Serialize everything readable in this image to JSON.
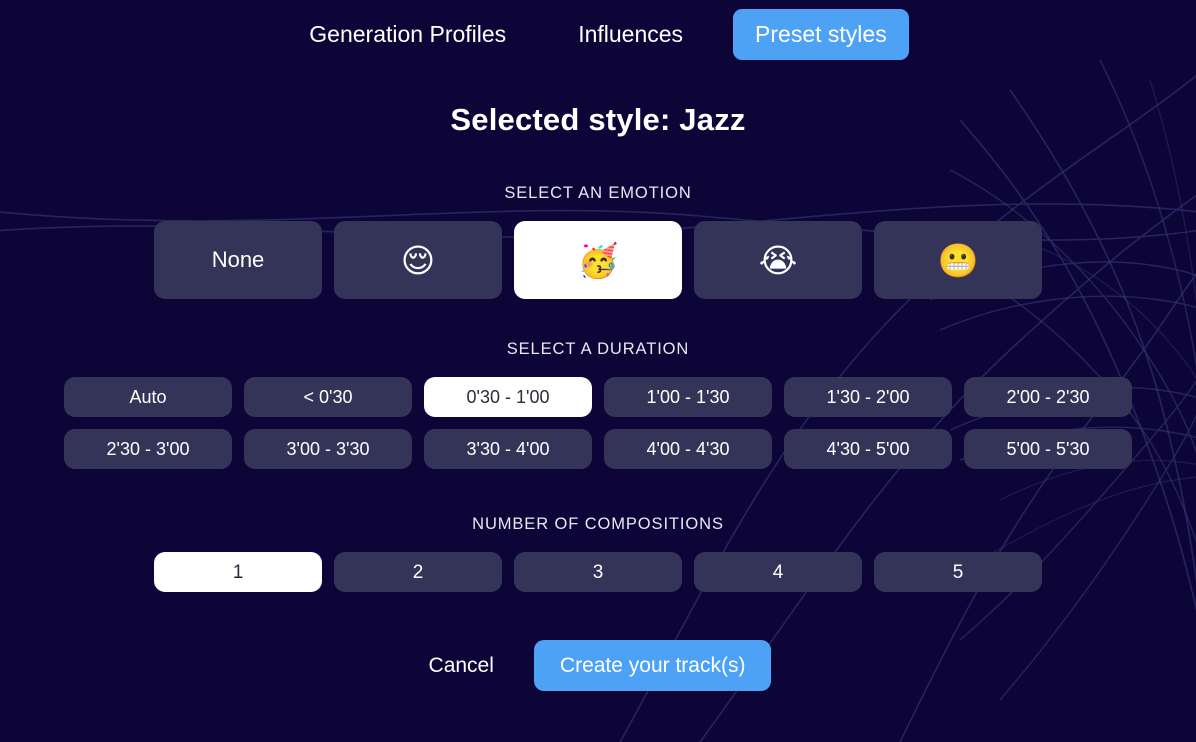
{
  "app": {
    "background_color": "#0d0538",
    "accent_color": "#4da2f5",
    "option_color": "#343459",
    "selected_color": "#ffffff"
  },
  "tabs": [
    {
      "label": "Generation Profiles",
      "active": false,
      "name": "tab-generation-profiles"
    },
    {
      "label": "Influences",
      "active": false,
      "name": "tab-influences"
    },
    {
      "label": "Preset styles",
      "active": true,
      "name": "tab-preset-styles"
    }
  ],
  "headline": "Selected style: Jazz",
  "sections": {
    "emotion": {
      "label": "SELECT AN EMOTION",
      "options": [
        {
          "label": "None",
          "icon": "",
          "icon_name": "none-label",
          "selected": false
        },
        {
          "label": "",
          "icon": "😌",
          "icon_name": "relieved-face-emoji",
          "selected": false
        },
        {
          "label": "",
          "icon": "🥳",
          "icon_name": "partying-face-emoji",
          "selected": true
        },
        {
          "label": "",
          "icon": "😭",
          "icon_name": "loudly-crying-emoji",
          "selected": false
        },
        {
          "label": "",
          "icon": "😬",
          "icon_name": "grimacing-face-emoji",
          "selected": false
        }
      ]
    },
    "duration": {
      "label": "SELECT A DURATION",
      "options": [
        {
          "label": "Auto",
          "selected": false
        },
        {
          "label": "< 0'30",
          "selected": false
        },
        {
          "label": "0'30 - 1'00",
          "selected": true
        },
        {
          "label": "1'00 - 1'30",
          "selected": false
        },
        {
          "label": "1'30 - 2'00",
          "selected": false
        },
        {
          "label": "2'00 - 2'30",
          "selected": false
        },
        {
          "label": "2'30 - 3'00",
          "selected": false
        },
        {
          "label": "3'00 - 3'30",
          "selected": false
        },
        {
          "label": "3'30 - 4'00",
          "selected": false
        },
        {
          "label": "4'00 - 4'30",
          "selected": false
        },
        {
          "label": "4'30 - 5'00",
          "selected": false
        },
        {
          "label": "5'00 - 5'30",
          "selected": false
        }
      ]
    },
    "compositions": {
      "label": "NUMBER OF COMPOSITIONS",
      "options": [
        {
          "label": "1",
          "selected": true
        },
        {
          "label": "2",
          "selected": false
        },
        {
          "label": "3",
          "selected": false
        },
        {
          "label": "4",
          "selected": false
        },
        {
          "label": "5",
          "selected": false
        }
      ]
    }
  },
  "actions": {
    "cancel_label": "Cancel",
    "create_label": "Create your track(s)"
  }
}
